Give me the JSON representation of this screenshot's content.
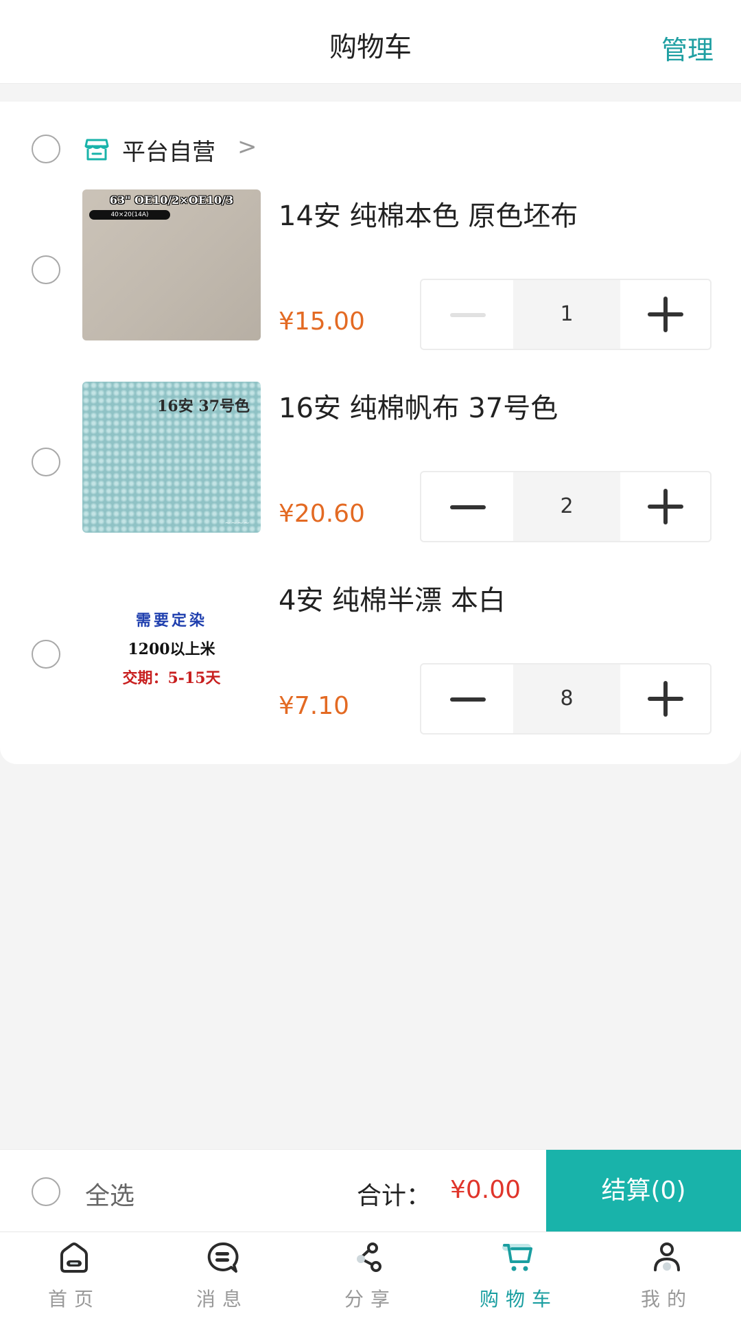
{
  "header": {
    "title": "购物车",
    "manage_label": "管理"
  },
  "store": {
    "name": "平台自营",
    "arrow": ">"
  },
  "items": [
    {
      "title": "14安 纯棉本色 原色坯布",
      "price": "¥15.00",
      "quantity": "1",
      "minus_disabled": true,
      "image_text": [
        "63\" OE10/2×OE10/3",
        "40×20(14A)"
      ]
    },
    {
      "title": "16安 纯棉帆布 37号色",
      "price": "¥20.60",
      "quantity": "2",
      "minus_disabled": false,
      "image_text": [
        "16安 37号色"
      ]
    },
    {
      "title": "4安 纯棉半漂 本白",
      "price": "¥7.10",
      "quantity": "8",
      "minus_disabled": false,
      "image_text": [
        "需要定染",
        "1200以上米",
        "交期：5-15天"
      ]
    }
  ],
  "summary": {
    "select_all_label": "全选",
    "total_label": "合计：",
    "total_value": "¥0.00",
    "checkout_label": "结算(0)"
  },
  "tabbar": {
    "tabs": [
      {
        "label": "首页",
        "icon": "home-icon"
      },
      {
        "label": "消息",
        "icon": "message-icon"
      },
      {
        "label": "分享",
        "icon": "share-icon"
      },
      {
        "label": "购物车",
        "icon": "cart-icon",
        "active": true
      },
      {
        "label": "我的",
        "icon": "profile-icon"
      }
    ]
  },
  "colors": {
    "accent": "#19b3aa",
    "manage": "#1f9fa2",
    "price": "#e36a23",
    "total": "#e0352b"
  }
}
